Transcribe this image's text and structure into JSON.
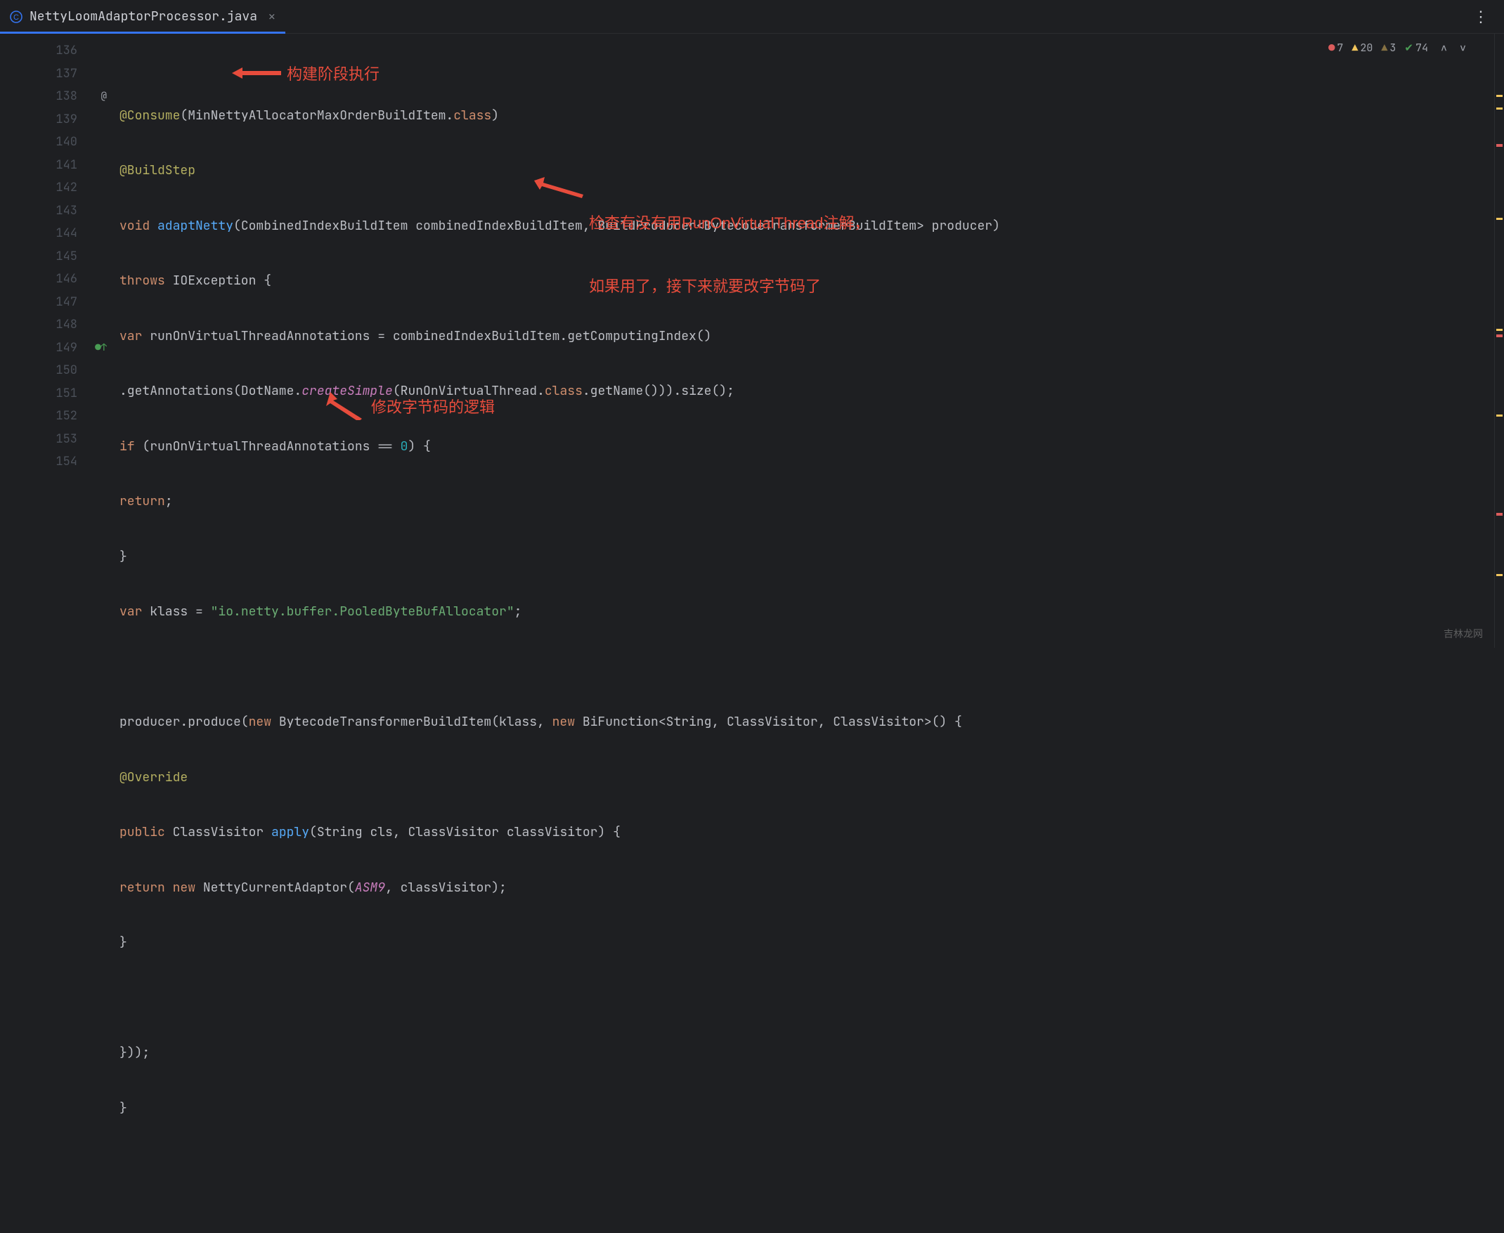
{
  "tab": {
    "filename": "NettyLoomAdaptorProcessor.java"
  },
  "inspections": {
    "errors": "7",
    "warnings": "20",
    "weak_warnings": "3",
    "ok": "74"
  },
  "lines": {
    "l136": "136",
    "l137": "137",
    "l138": "138",
    "l139": "139",
    "l140": "140",
    "l141": "141",
    "l142": "142",
    "l143": "143",
    "l144": "144",
    "l145": "145",
    "l146": "146",
    "l147": "147",
    "l148": "148",
    "l149": "149",
    "l150": "150",
    "l151": "151",
    "l152": "152",
    "l153": "153",
    "l154": "154"
  },
  "code": {
    "l136_ann": "@Consume",
    "l136_p1": "(",
    "l136_arg": "MinNettyAllocatorMaxOrderBuildItem",
    "l136_dot": ".",
    "l136_cls": "class",
    "l136_p2": ")",
    "l137_ann": "@BuildStep",
    "l138_kw": "void ",
    "l138_fn": "adaptNetty",
    "l138_p1": "(",
    "l138_t1": "CombinedIndexBuildItem ",
    "l138_a1": "combinedIndexBuildItem",
    "l138_c": ", ",
    "l138_t2": "BuildProducer",
    "l138_lt": "<",
    "l138_t3": "BytecodeTransformerBuildItem",
    "l138_gt": "> ",
    "l138_a2": "producer",
    "l138_p2": ")",
    "l139_kw": "throws ",
    "l139_ex": "IOException ",
    "l139_b": "{",
    "l140_kw": "var ",
    "l140_v": "runOnVirtualThreadAnnotations ",
    "l140_eq": "= ",
    "l140_o": "combinedIndexBuildItem",
    "l140_m1": ".getComputingIndex()",
    "l141_m1": ".getAnnotations(",
    "l141_t1": "DotName",
    "l141_d1": ".",
    "l141_m2": "createSimple",
    "l141_p1": "(",
    "l141_t2": "RunOnVirtualThread",
    "l141_d2": ".",
    "l141_cls": "class",
    "l141_m3": ".getName())).size();",
    "l142_kw": "if ",
    "l142_p1": "(",
    "l142_v": "runOnVirtualThreadAnnotations ",
    "l142_eq": "== ",
    "l142_n": "0",
    "l142_p2": ") {",
    "l143_kw": "return",
    "l143_s": ";",
    "l144_b": "}",
    "l145_kw": "var ",
    "l145_v": "klass ",
    "l145_eq": "= ",
    "l145_s": "\"io.netty.buffer.PooledByteBufAllocator\"",
    "l145_sc": ";",
    "l147_o": "producer",
    "l147_m": ".produce(",
    "l147_kw": "new ",
    "l147_t": "BytecodeTransformerBuildItem(",
    "l147_a1": "klass",
    "l147_c": ", ",
    "l147_kw2": "new ",
    "l147_t2": "BiFunction",
    "l147_lt": "<",
    "l147_t3": "String, ClassVisitor, ClassVisitor",
    "l147_gt": ">() {",
    "l148_ann": "@Override",
    "l149_kw": "public ",
    "l149_t": "ClassVisitor ",
    "l149_fn": "apply",
    "l149_p1": "(",
    "l149_t1": "String ",
    "l149_a1": "cls",
    "l149_c": ", ",
    "l149_t2": "ClassVisitor ",
    "l149_a2": "classVisitor",
    "l149_p2": ") {",
    "l150_kw": "return new ",
    "l150_t": "NettyCurrentAdaptor(",
    "l150_a1": "ASM9",
    "l150_c": ", ",
    "l150_a2": "classVisitor",
    "l150_p2": ");",
    "l151_b": "}",
    "l153_b": "}));",
    "l154_b": "}"
  },
  "annotations": {
    "a1": "构建阶段执行",
    "a2_l1": "检查有没有用RunOnVirtualThread注解，",
    "a2_l2": "如果用了，接下来就要改字节码了",
    "a3": "修改字节码的逻辑"
  },
  "watermark": "吉林龙网"
}
